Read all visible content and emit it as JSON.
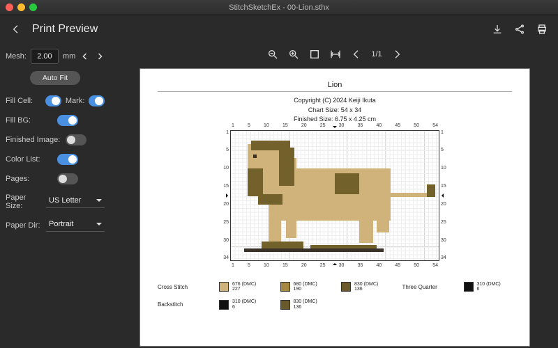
{
  "window": {
    "title": "StitchSketchEx - 00-Lion.sthx"
  },
  "header": {
    "page_title": "Print Preview"
  },
  "sidebar": {
    "mesh_label": "Mesh:",
    "mesh_value": "2.00",
    "mesh_unit": "mm",
    "auto_fit": "Auto Fit",
    "fill_cell": "Fill Cell:",
    "mark": "Mark:",
    "fill_bg": "Fill BG:",
    "finished_image": "Finished Image:",
    "color_list": "Color List:",
    "pages": "Pages:",
    "paper_size_label": "Paper Size:",
    "paper_size_value": "US Letter",
    "paper_dir_label": "Paper Dir:",
    "paper_dir_value": "Portrait"
  },
  "toolbar": {
    "page_indicator": "1/1"
  },
  "document": {
    "title": "Lion",
    "copyright": "Copyright (C) 2024 Keiji Ikuta",
    "chart_size": "Chart Size: 54 x 34",
    "finished_size": "Finished Size: 6.75 x 4.25 cm",
    "top_ticks": [
      "1",
      "5",
      "10",
      "15",
      "20",
      "25",
      "30",
      "35",
      "40",
      "45",
      "50",
      "54"
    ],
    "left_ticks": [
      "1",
      "5",
      "10",
      "15",
      "20",
      "25",
      "30",
      "34"
    ],
    "right_ticks": [
      "1",
      "5",
      "10",
      "15",
      "20",
      "25",
      "30",
      "34"
    ],
    "bot_ticks": [
      "1",
      "5",
      "10",
      "15",
      "20",
      "25",
      "30",
      "35",
      "40",
      "45",
      "50",
      "54"
    ]
  },
  "legend": {
    "cross_stitch_label": "Cross Stitch",
    "backstitch_label": "Backstitch",
    "three_quarter_label": "Three Quarter",
    "cs1": {
      "code": "676 (DMC)",
      "count": "227",
      "color": "#d0b27b"
    },
    "cs2": {
      "code": "680 (DMC)",
      "count": "190",
      "color": "#a68940"
    },
    "cs3": {
      "code": "830 (DMC)",
      "count": "136",
      "color": "#6a5a2b"
    },
    "tq1": {
      "code": "310 (DMC)",
      "count": "6",
      "color": "#111111"
    },
    "bs1": {
      "code": "310 (DMC)",
      "count": "6",
      "color": "#111111"
    },
    "bs2": {
      "code": "830 (DMC)",
      "count": "136",
      "color": "#6a5a2b"
    }
  }
}
